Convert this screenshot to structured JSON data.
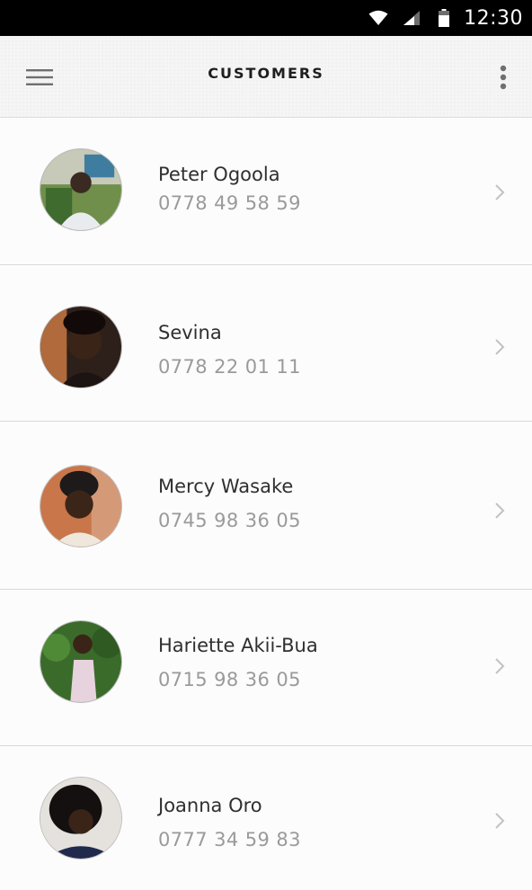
{
  "status_bar": {
    "time": "12:30",
    "icons": [
      "wifi-icon",
      "signal-icon",
      "battery-icon"
    ]
  },
  "app_bar": {
    "title": "CUSTOMERS",
    "left_icon": "hamburger-menu-icon",
    "right_icon": "more-vertical-icon"
  },
  "customers": [
    {
      "name": "Peter Ogoola",
      "phone": "0778 49 58 59",
      "avatar": "avatar-photo"
    },
    {
      "name": "Sevina",
      "phone": "0778 22 01 11",
      "avatar": "avatar-photo"
    },
    {
      "name": "Mercy Wasake",
      "phone": "0745 98 36 05",
      "avatar": "avatar-photo"
    },
    {
      "name": "Hariette Akii-Bua",
      "phone": "0715 98 36 05",
      "avatar": "avatar-photo"
    },
    {
      "name": "Joanna Oro",
      "phone": "0777 34 59 83",
      "avatar": "avatar-photo"
    }
  ],
  "colors": {
    "status_bar_bg": "#000000",
    "app_bar_bg": "#f5f5f5",
    "name_text": "#2f2f2f",
    "phone_text": "#9a9a9a",
    "chevron": "#c2c2c2",
    "divider": "#d6d9dd"
  }
}
